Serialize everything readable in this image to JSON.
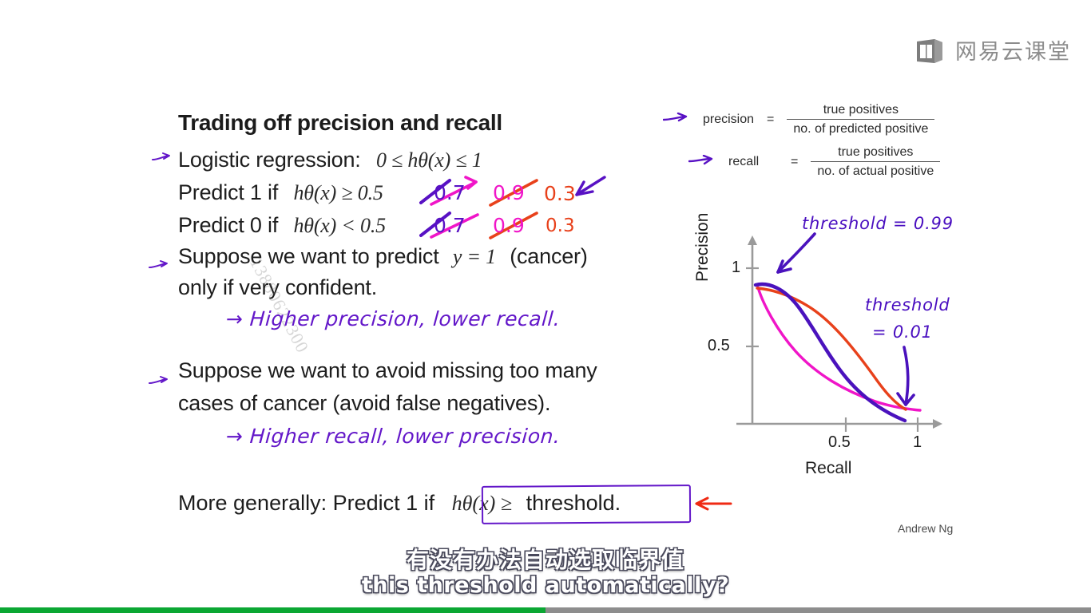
{
  "logo": {
    "icon": "netease-classroom-icon",
    "text": "网易云课堂"
  },
  "slide": {
    "title": "Trading off precision and recall",
    "lines": {
      "logistic_label": "Logistic regression:",
      "logistic_math": "0 ≤ hθ(x) ≤ 1",
      "predict1_label": "Predict 1 if",
      "predict1_math": "hθ(x) ≥ 0.5",
      "predict0_label": "Predict 0 if",
      "predict0_math": "hθ(x) < 0.5",
      "suppose1_a": "Suppose we want to predict",
      "suppose1_math": "y = 1",
      "suppose1_b": "(cancer)",
      "suppose1_c": "only if very confident.",
      "suppose2_a": "Suppose we want to avoid missing too many",
      "suppose2_b": "cases of cancer (avoid false negatives).",
      "more_generally": "More generally: Predict 1 if",
      "boxed_math": "hθ(x) ≥",
      "boxed_word": "threshold."
    },
    "signature": "Andrew Ng",
    "watermark": "13880622300"
  },
  "annotations": {
    "threshold_values_row1": [
      "0.7",
      "0.9",
      "0.3"
    ],
    "threshold_values_row2": [
      "0.7",
      "0.9",
      "0.3"
    ],
    "note_higher_precision": "→ Higher precision, lower recall.",
    "note_higher_recall": "→ Higher recall, lower precision.",
    "chart_note_high": "threshold = 0.99",
    "chart_note_low_1": "threshold",
    "chart_note_low_2": "= 0.01",
    "colors": {
      "purple": "#5811c4",
      "magenta": "#f015c8",
      "orange": "#e8411b"
    }
  },
  "formulas": {
    "precision": {
      "name": "precision",
      "equals": "=",
      "numerator": "true positives",
      "denominator": "no. of predicted positive"
    },
    "recall": {
      "name": "recall",
      "equals": "=",
      "numerator": "true positives",
      "denominator": "no. of actual positive"
    }
  },
  "chart_data": {
    "type": "line",
    "title": "",
    "xlabel": "Recall",
    "ylabel": "Precision",
    "xlim": [
      0,
      1.1
    ],
    "ylim": [
      0,
      1.1
    ],
    "xticks": [
      "0.5",
      "1"
    ],
    "yticks": [
      "0.5",
      "1"
    ],
    "grid": false,
    "legend": "none",
    "series": [
      {
        "name": "curve-purple",
        "color": "#4a12bd",
        "x": [
          0.03,
          0.12,
          0.22,
          0.32,
          0.42,
          0.55,
          0.68,
          0.8,
          0.9,
          0.95
        ],
        "y": [
          0.9,
          0.91,
          0.86,
          0.76,
          0.62,
          0.47,
          0.34,
          0.23,
          0.13,
          0.05
        ]
      },
      {
        "name": "curve-orange",
        "color": "#e8411b",
        "x": [
          0.03,
          0.14,
          0.26,
          0.38,
          0.5,
          0.62,
          0.74,
          0.84,
          0.92,
          0.96
        ],
        "y": [
          0.89,
          0.86,
          0.8,
          0.72,
          0.62,
          0.51,
          0.38,
          0.26,
          0.14,
          0.06
        ]
      },
      {
        "name": "curve-magenta",
        "color": "#f015c8",
        "x": [
          0.03,
          0.1,
          0.2,
          0.32,
          0.45,
          0.58,
          0.7,
          0.82,
          0.92,
          1.0
        ],
        "y": [
          0.89,
          0.72,
          0.56,
          0.42,
          0.31,
          0.22,
          0.15,
          0.1,
          0.07,
          0.05
        ]
      }
    ],
    "annotations": [
      {
        "text": "threshold = 0.99",
        "points_to": [
          0.07,
          0.93
        ]
      },
      {
        "text": "threshold = 0.01",
        "points_to": [
          0.95,
          0.06
        ]
      }
    ]
  },
  "subtitles": {
    "chinese": "有没有办法自动选取临界值",
    "english": "this threshold automatically?"
  },
  "player": {
    "progress_percent": 50,
    "fill_color": "#0ba733",
    "track_color": "#8d8d8d"
  }
}
